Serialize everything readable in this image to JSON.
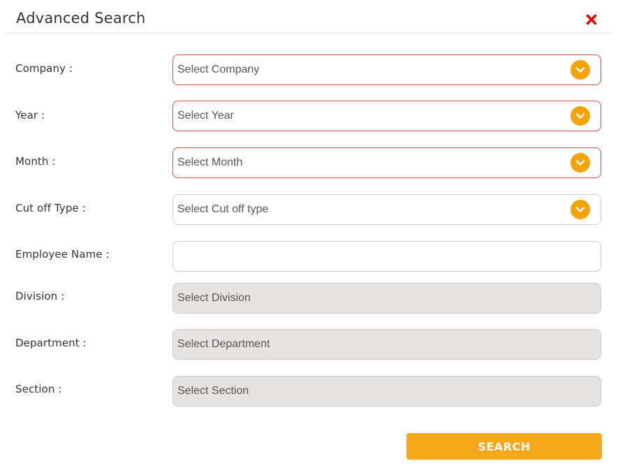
{
  "dialog": {
    "title": "Advanced Search",
    "close_icon": "close-x-icon",
    "accent_color": "#f5a300",
    "error_border_color": "#d9534f",
    "close_color": "#e00000"
  },
  "form": {
    "company": {
      "label": "Company :",
      "placeholder": "Select Company"
    },
    "year": {
      "label": "Year :",
      "placeholder": "Select Year"
    },
    "month": {
      "label": "Month :",
      "placeholder": "Select Month"
    },
    "cutoff": {
      "label": "Cut off Type :",
      "placeholder": "Select Cut off type"
    },
    "employee": {
      "label": "Employee Name :",
      "value": ""
    },
    "division": {
      "label": "Division :",
      "placeholder": "Select Division"
    },
    "department": {
      "label": "Department :",
      "placeholder": "Select Department"
    },
    "section": {
      "label": "Section :",
      "placeholder": "Select Section"
    }
  },
  "actions": {
    "search_label": "SEARCH"
  }
}
